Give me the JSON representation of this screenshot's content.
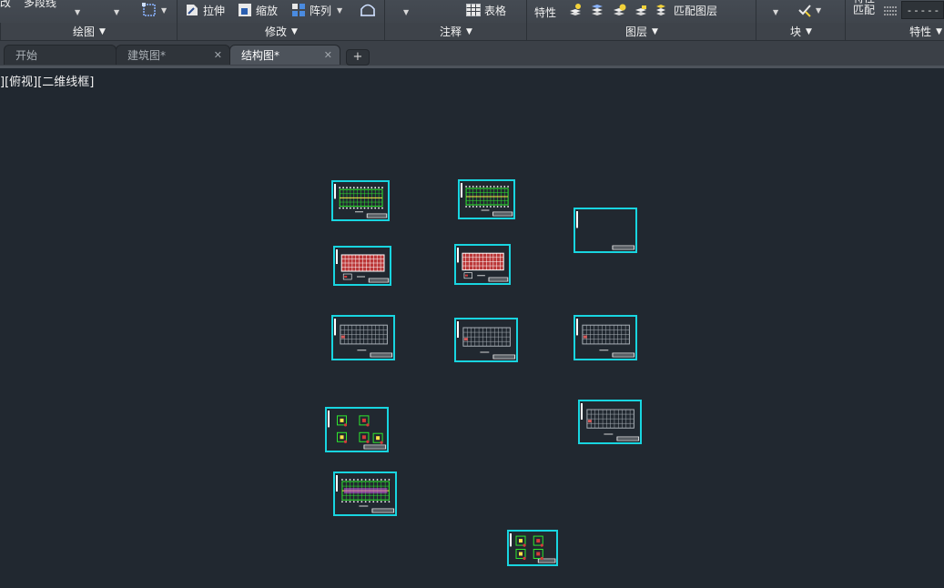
{
  "ribbon": {
    "left_clipped_1": "改",
    "left_clipped_2": "多段线",
    "stretch": "拉伸",
    "scale": "缩放",
    "array": "阵列",
    "table": "表格",
    "properties": "特性",
    "match_layer": "匹配图层",
    "match_top": "特性",
    "match_bottom": "匹配",
    "linetype": "- - - - -",
    "panels": {
      "draw": "绘图",
      "modify": "修改",
      "annotate": "注释",
      "layers": "图层",
      "block": "块",
      "props": "特性"
    }
  },
  "tabs": [
    {
      "label": "开始",
      "active": false
    },
    {
      "label": "建筑图*",
      "active": false
    },
    {
      "label": "结构图*",
      "active": true
    }
  ],
  "tab_close": "✕",
  "tab_add": "+",
  "viewport": {
    "label": "][俯视][二维线框]"
  },
  "drawing_sheets": [
    {
      "name": "sheet-1",
      "content": "plan-green"
    },
    {
      "name": "sheet-2",
      "content": "plan-green"
    },
    {
      "name": "sheet-3",
      "content": "empty"
    },
    {
      "name": "sheet-4",
      "content": "plan-red"
    },
    {
      "name": "sheet-5",
      "content": "plan-red"
    },
    {
      "name": "sheet-6",
      "content": "plan-grey"
    },
    {
      "name": "sheet-7",
      "content": "plan-grey"
    },
    {
      "name": "sheet-8",
      "content": "plan-grey"
    },
    {
      "name": "sheet-9",
      "content": "details"
    },
    {
      "name": "sheet-10",
      "content": "plan-grey"
    },
    {
      "name": "sheet-11",
      "content": "plan-green-magenta"
    },
    {
      "name": "sheet-12",
      "content": "details"
    }
  ],
  "colors": {
    "canvas": "#212830",
    "sheet_border": "#18d5e0",
    "accent_green": "#2ee82e",
    "accent_red": "#d63a3a"
  }
}
